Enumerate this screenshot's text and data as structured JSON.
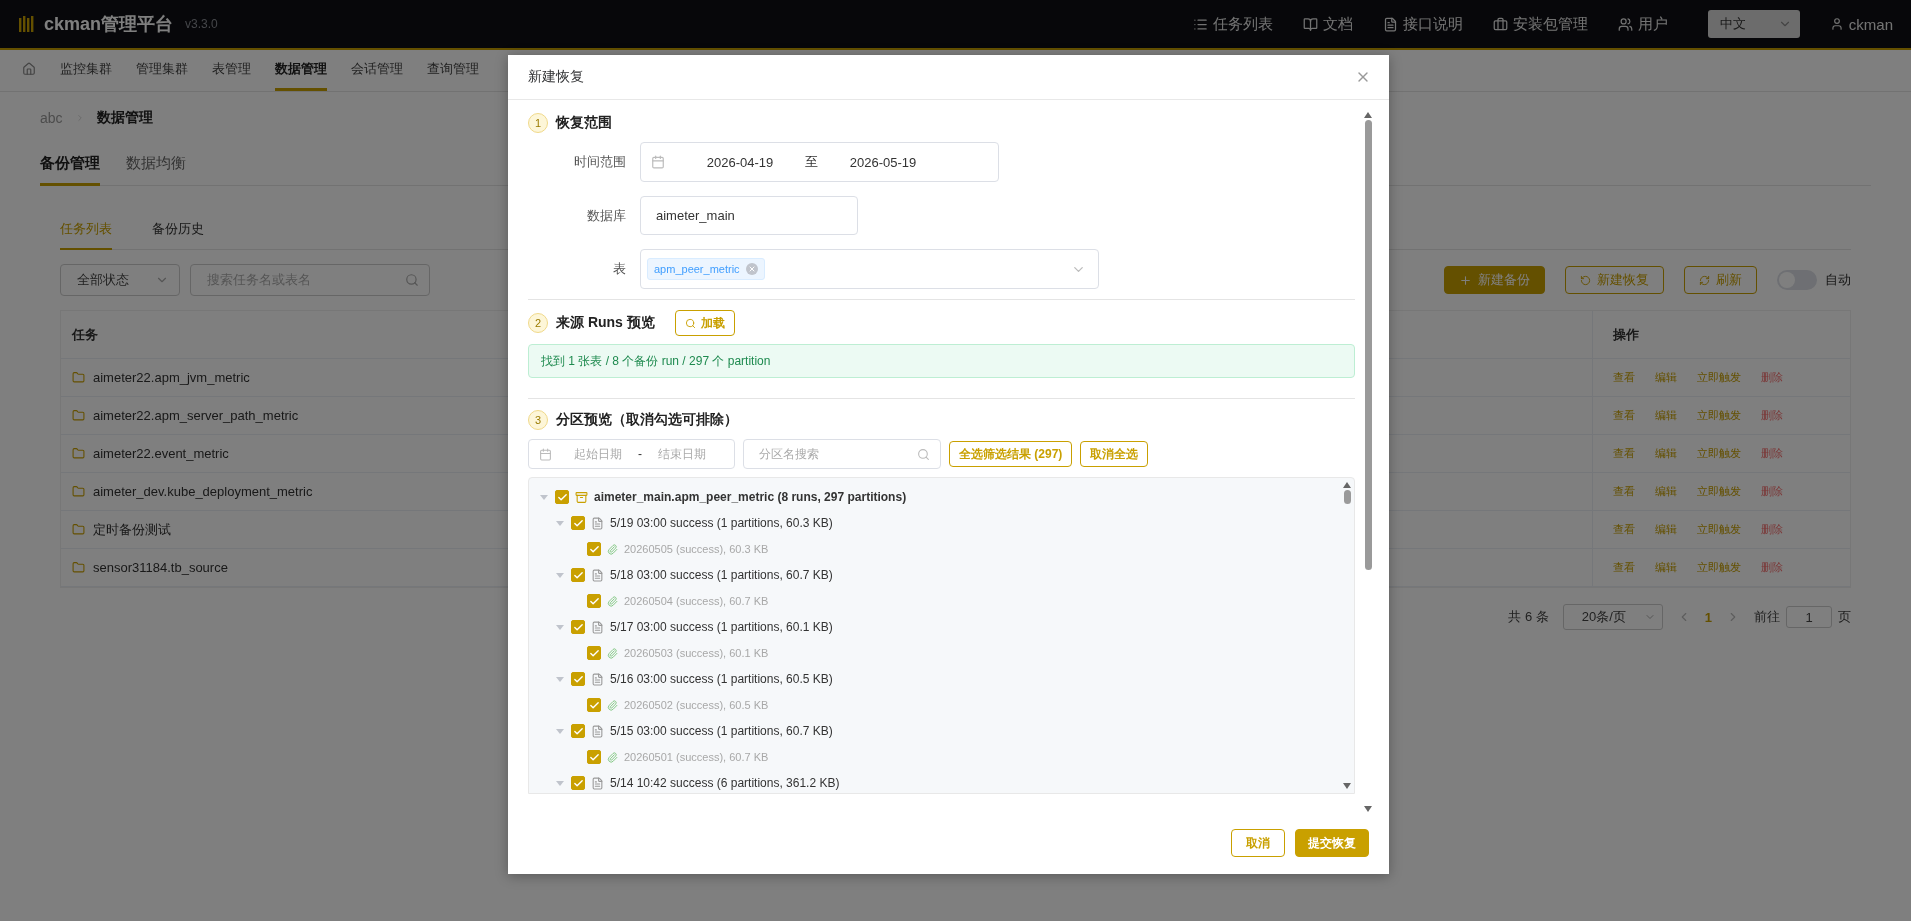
{
  "topbar": {
    "logo": "ckman管理平台",
    "version": "v3.3.0",
    "links": [
      {
        "kind": "tasks",
        "label": "任务列表"
      },
      {
        "kind": "docs",
        "label": "文档"
      },
      {
        "kind": "api",
        "label": "接口说明"
      },
      {
        "kind": "package",
        "label": "安装包管理"
      },
      {
        "kind": "users",
        "label": "用户"
      }
    ],
    "language": "中文",
    "user": "ckman"
  },
  "nav": {
    "items": [
      {
        "label": "监控集群",
        "selected": false
      },
      {
        "label": "管理集群",
        "selected": false
      },
      {
        "label": "表管理",
        "selected": false
      },
      {
        "label": "数据管理",
        "selected": true
      },
      {
        "label": "会话管理",
        "selected": false
      },
      {
        "label": "查询管理",
        "selected": false
      }
    ]
  },
  "breadcrumb": [
    "abc",
    "数据管理"
  ],
  "tabs": [
    {
      "label": "备份管理",
      "selected": true
    },
    {
      "label": "数据均衡",
      "selected": false
    }
  ],
  "subtabs": [
    {
      "label": "任务列表",
      "selected": true
    },
    {
      "label": "备份历史",
      "selected": false
    }
  ],
  "filters": {
    "status": "全部状态",
    "search_placeholder": "搜索任务名或表名"
  },
  "actions": {
    "new_backup": "新建备份",
    "new_restore": "新建恢复",
    "refresh": "刷新",
    "auto": {
      "label": "自动",
      "on": false
    }
  },
  "table": {
    "columns": [
      "任务",
      "操作"
    ],
    "rows": [
      {
        "task": "aimeter22.apm_jvm_metric",
        "ops": [
          "查看",
          "编辑",
          "立即触发",
          "删除"
        ]
      },
      {
        "task": "aimeter22.apm_server_path_metric",
        "ops": [
          "查看",
          "编辑",
          "立即触发",
          "删除"
        ]
      },
      {
        "task": "aimeter22.event_metric",
        "ops": [
          "查看",
          "编辑",
          "立即触发",
          "删除"
        ]
      },
      {
        "task": "aimeter_dev.kube_deployment_metric",
        "ops": [
          "查看",
          "编辑",
          "立即触发",
          "删除"
        ]
      },
      {
        "task": "定时备份测试",
        "ops": [
          "查看",
          "编辑",
          "立即触发",
          "删除"
        ]
      },
      {
        "task": "sensor31184.tb_source",
        "ops": [
          "查看",
          "编辑",
          "立即触发",
          "删除"
        ]
      }
    ]
  },
  "pagination": {
    "total": "共 6 条",
    "page_size": "20条/页",
    "current": "1",
    "goto_label": "前往",
    "goto_value": "1",
    "page_suffix": "页"
  },
  "dialog": {
    "title": "新建恢复",
    "section1": {
      "number": "1",
      "title": "恢复范围",
      "time_label": "时间范围",
      "start": "2026-04-19",
      "separator": "至",
      "end": "2026-05-19",
      "db_label": "数据库",
      "db_value": "aimeter_main",
      "table_label": "表",
      "table_tags": [
        "apm_peer_metric"
      ]
    },
    "section2": {
      "number": "2",
      "title": "来源 Runs 预览",
      "load": "加载",
      "alert": "找到 1 张表 / 8 个备份 run / 297 个 partition"
    },
    "section3": {
      "number": "3",
      "title": "分区预览（取消勾选可排除）",
      "start_placeholder": "起始日期",
      "range_sep": "-",
      "end_placeholder": "结束日期",
      "search_placeholder": "分区名搜索",
      "select_all": "全选筛选结果 (297)",
      "clear_all": "取消全选",
      "tree": [
        {
          "label": "aimeter_main.apm_peer_metric (8 runs, 297 partitions)",
          "checked": true,
          "expanded": true,
          "children": [
            {
              "label": "5/19 03:00 success (1 partitions, 60.3 KB)",
              "checked": true,
              "expanded": true,
              "children": [
                {
                  "label": "20260505 (success), 60.3 KB",
                  "checked": true
                }
              ]
            },
            {
              "label": "5/18 03:00 success (1 partitions, 60.7 KB)",
              "checked": true,
              "expanded": true,
              "children": [
                {
                  "label": "20260504 (success), 60.7 KB",
                  "checked": true
                }
              ]
            },
            {
              "label": "5/17 03:00 success (1 partitions, 60.1 KB)",
              "checked": true,
              "expanded": true,
              "children": [
                {
                  "label": "20260503 (success), 60.1 KB",
                  "checked": true
                }
              ]
            },
            {
              "label": "5/16 03:00 success (1 partitions, 60.5 KB)",
              "checked": true,
              "expanded": true,
              "children": [
                {
                  "label": "20260502 (success), 60.5 KB",
                  "checked": true
                }
              ]
            },
            {
              "label": "5/15 03:00 success (1 partitions, 60.7 KB)",
              "checked": true,
              "expanded": true,
              "children": [
                {
                  "label": "20260501 (success), 60.7 KB",
                  "checked": true
                }
              ]
            },
            {
              "label": "5/14 10:42 success (6 partitions, 361.2 KB)",
              "checked": true,
              "expanded": true
            }
          ]
        }
      ]
    },
    "cancel": "取消",
    "submit": "提交恢复"
  }
}
